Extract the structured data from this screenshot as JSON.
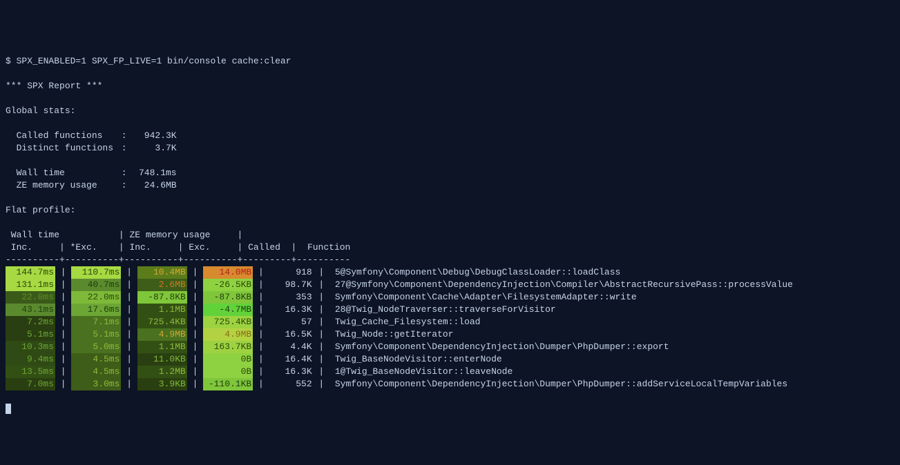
{
  "prompt": "$ ",
  "command": "SPX_ENABLED=1 SPX_FP_LIVE=1 bin/console cache:clear",
  "report_title": "*** SPX Report ***",
  "global_stats_label": "Global stats:",
  "stats": {
    "called_functions": {
      "label": "Called functions",
      "value": "942.3K"
    },
    "distinct_functions": {
      "label": "Distinct functions",
      "value": "3.7K"
    },
    "wall_time": {
      "label": "Wall time",
      "value": "748.1ms"
    },
    "ze_memory": {
      "label": "ZE memory usage",
      "value": "24.6MB"
    }
  },
  "flat_profile_label": "Flat profile:",
  "headers": {
    "group1": " Wall time           ",
    "group2": " ZE memory usage     ",
    "inc": " Inc.     ",
    "exc": " *Exc.    ",
    "minc": " Inc.     ",
    "mexc": " Exc.     ",
    "called": " Called  ",
    "function": "Function"
  },
  "divider": "----------+----------+----------+----------+---------+----------",
  "rows": [
    {
      "inc": "144.7ms",
      "exc": "110.7ms",
      "minc": "10.4MB",
      "mexc": "14.0MB",
      "called": "918",
      "fn": "5@Symfony\\Component\\Debug\\DebugClassLoader::loadClass",
      "c": {
        "inc": "#a7d943",
        "exc": "#a7d943",
        "minc": "#5b7c1b",
        "mexc": "#d88a2f",
        "t": {
          "inc": "#2b4a0b",
          "exc": "#2b4a0b",
          "minc": "#d6a62f",
          "mexc": "#b3201a"
        }
      }
    },
    {
      "inc": "131.1ms",
      "exc": "40.7ms",
      "minc": "2.6MB",
      "mexc": "-26.5KB",
      "called": "98.7K",
      "fn": "27@Symfony\\Component\\DependencyInjection\\Compiler\\AbstractRecursivePass::processValue",
      "c": {
        "inc": "#a7d943",
        "exc": "#5b8a2e",
        "minc": "#3e5d18",
        "mexc": "#8fd241",
        "t": {
          "inc": "#2b4a0b",
          "exc": "#1f3d10",
          "minc": "#c97b20",
          "mexc": "#2b4a0b"
        }
      }
    },
    {
      "inc": "22.0ms",
      "exc": "22.0ms",
      "minc": "-87.8KB",
      "mexc": "-87.8KB",
      "called": "353",
      "fn": "Symfony\\Component\\Cache\\Adapter\\FilesystemAdapter::write",
      "c": {
        "inc": "#3a5a1a",
        "exc": "#7fb939",
        "minc": "#7fc63a",
        "mexc": "#7fc63a",
        "t": {
          "inc": "#5c8f26",
          "exc": "#2b4a0b",
          "minc": "#1f3d10",
          "mexc": "#1f3d10"
        }
      }
    },
    {
      "inc": "43.1ms",
      "exc": "17.6ms",
      "minc": "1.1MB",
      "mexc": "-4.7MB",
      "called": "16.3K",
      "fn": "28@Twig_NodeTraverser::traverseForVisitor",
      "c": {
        "inc": "#5b8a2e",
        "exc": "#6ca635",
        "minc": "#335014",
        "mexc": "#62d23a",
        "t": {
          "inc": "#1f3d10",
          "exc": "#1f3d10",
          "minc": "#8fb93a",
          "mexc": "#1f3d10"
        }
      }
    },
    {
      "inc": "7.2ms",
      "exc": "7.1ms",
      "minc": "725.4KB",
      "mexc": "725.4KB",
      "called": "57",
      "fn": "Twig_Cache_Filesystem::load",
      "c": {
        "inc": "#2a3f11",
        "exc": "#4a711f",
        "minc": "#335014",
        "mexc": "#9dd241",
        "t": {
          "inc": "#6ca635",
          "exc": "#8fb93a",
          "minc": "#8fb93a",
          "mexc": "#2b4a0b"
        }
      }
    },
    {
      "inc": "5.1ms",
      "exc": "5.1ms",
      "minc": "4.9MB",
      "mexc": "4.9MB",
      "called": "16.5K",
      "fn": "Twig_Node::getIterator",
      "c": {
        "inc": "#2a3f11",
        "exc": "#4a711f",
        "minc": "#4a711f",
        "mexc": "#b3d241",
        "t": {
          "inc": "#6ca635",
          "exc": "#8fb93a",
          "minc": "#d6a62f",
          "mexc": "#8a6a1a"
        }
      }
    },
    {
      "inc": "10.3ms",
      "exc": "5.0ms",
      "minc": "1.1MB",
      "mexc": "163.7KB",
      "called": "4.4K",
      "fn": "Symfony\\Component\\DependencyInjection\\Dumper\\PhpDumper::export",
      "c": {
        "inc": "#2f4a14",
        "exc": "#4a711f",
        "minc": "#335014",
        "mexc": "#9dd241",
        "t": {
          "inc": "#6ca635",
          "exc": "#8fb93a",
          "minc": "#8fb93a",
          "mexc": "#2b4a0b"
        }
      }
    },
    {
      "inc": "9.4ms",
      "exc": "4.5ms",
      "minc": "11.0KB",
      "mexc": "0B",
      "called": "16.4K",
      "fn": "Twig_BaseNodeVisitor::enterNode",
      "c": {
        "inc": "#2f4a14",
        "exc": "#3e5d18",
        "minc": "#2a3f11",
        "mexc": "#8fd241",
        "t": {
          "inc": "#6ca635",
          "exc": "#8fb93a",
          "minc": "#7fb939",
          "mexc": "#2b4a0b"
        }
      }
    },
    {
      "inc": "13.5ms",
      "exc": "4.5ms",
      "minc": "1.2MB",
      "mexc": "0B",
      "called": "16.3K",
      "fn": "1@Twig_BaseNodeVisitor::leaveNode",
      "c": {
        "inc": "#335014",
        "exc": "#3e5d18",
        "minc": "#335014",
        "mexc": "#8fd241",
        "t": {
          "inc": "#6ca635",
          "exc": "#8fb93a",
          "minc": "#8fb93a",
          "mexc": "#2b4a0b"
        }
      }
    },
    {
      "inc": "7.0ms",
      "exc": "3.0ms",
      "minc": "3.9KB",
      "mexc": "-110.1KB",
      "called": "552",
      "fn": "Symfony\\Component\\DependencyInjection\\Dumper\\PhpDumper::addServiceLocalTempVariables",
      "c": {
        "inc": "#2a3f11",
        "exc": "#3e5d18",
        "minc": "#2a3f11",
        "mexc": "#7fc63a",
        "t": {
          "inc": "#6ca635",
          "exc": "#8fb93a",
          "minc": "#7fb939",
          "mexc": "#1f3d10"
        }
      }
    }
  ]
}
